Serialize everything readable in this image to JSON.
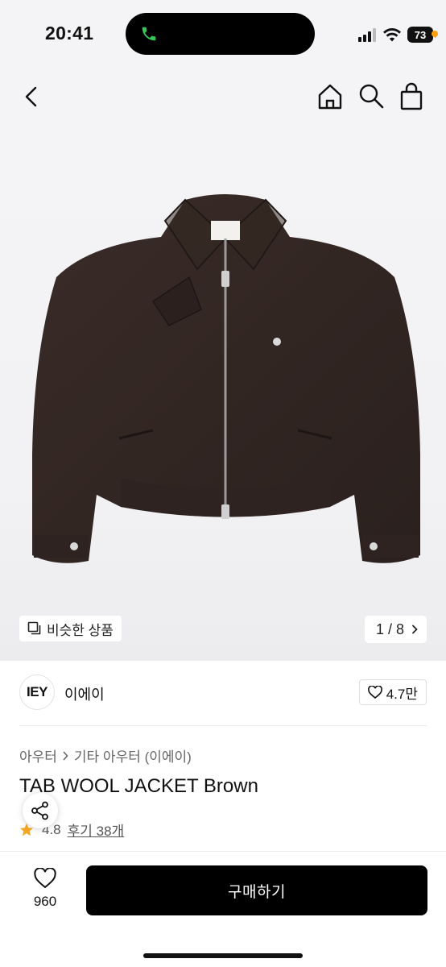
{
  "status_bar": {
    "time": "20:41",
    "battery": "73"
  },
  "nav": {
    "back_icon": "chevron-left-icon",
    "home_icon": "home-icon",
    "search_icon": "search-icon",
    "cart_icon": "shopping-bag-icon"
  },
  "image_area": {
    "similar_label": "비슷한 상품",
    "page_counter": "1 / 8",
    "current_page": 1,
    "total_pages": 8,
    "image_subject": "dark brown wool zip-up jacket"
  },
  "brand": {
    "logo_text": "IEY",
    "name": "이에이",
    "likes": "4.7만"
  },
  "breadcrumb": {
    "category": "아우터",
    "subcategory": "기타 아우터 (이에이)"
  },
  "product": {
    "title": "TAB WOOL JACKET Brown",
    "rating": "4.8",
    "reviews_label": "후기 38개"
  },
  "bottom_bar": {
    "wish_count": "960",
    "buy_label": "구매하기"
  },
  "colors": {
    "accent": "#000000",
    "star": "#f5a623",
    "image_bg": "#f4f4f6"
  }
}
